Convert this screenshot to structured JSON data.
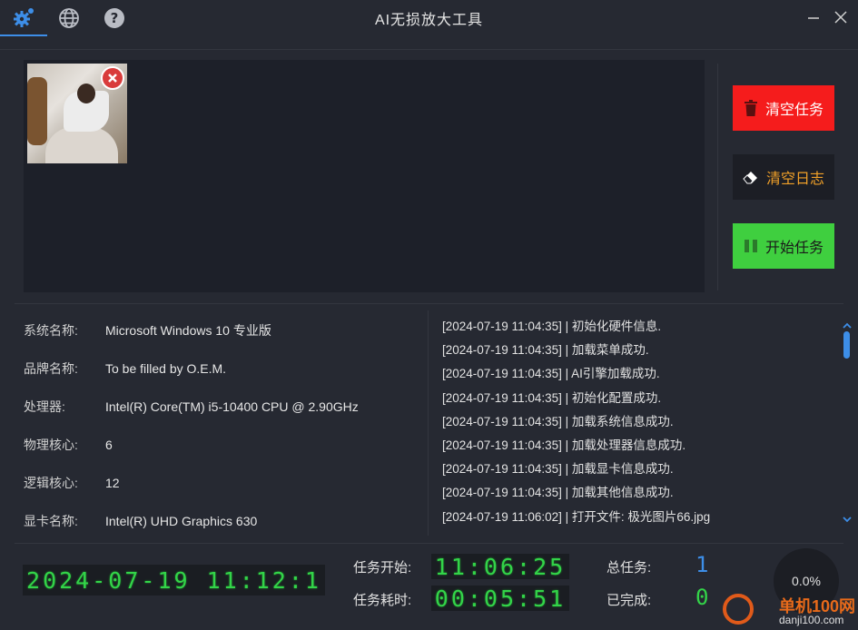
{
  "window": {
    "title": "AI无损放大工具"
  },
  "toolbar": {
    "icons": [
      "gear-icon",
      "globe-icon",
      "help-icon"
    ],
    "accent": "#3d8ee8"
  },
  "actions": {
    "clear_tasks": "清空任务",
    "clear_log": "清空日志",
    "start_task": "开始任务",
    "colors": {
      "clear_tasks": "#f51c1c",
      "clear_log_text": "#f0a028",
      "start_task": "#3fcf3f"
    }
  },
  "system_info": [
    {
      "label": "系统名称:",
      "value": "Microsoft Windows 10 专业版"
    },
    {
      "label": "品牌名称:",
      "value": "To be filled by O.E.M."
    },
    {
      "label": "处理器:",
      "value": "Intel(R) Core(TM) i5-10400 CPU @ 2.90GHz"
    },
    {
      "label": "物理核心:",
      "value": "6"
    },
    {
      "label": "逻辑核心:",
      "value": "12"
    },
    {
      "label": "显卡名称:",
      "value": "Intel(R) UHD Graphics 630"
    }
  ],
  "log": [
    "[2024-07-19 11:04:35] | 初始化硬件信息.",
    "[2024-07-19 11:04:35] | 加载菜单成功.",
    "[2024-07-19 11:04:35] | AI引擎加载成功.",
    "[2024-07-19 11:04:35] | 初始化配置成功.",
    "[2024-07-19 11:04:35] | 加载系统信息成功.",
    "[2024-07-19 11:04:35] | 加载处理器信息成功.",
    "[2024-07-19 11:04:35] | 加载显卡信息成功.",
    "[2024-07-19 11:04:35] | 加载其他信息成功.",
    "[2024-07-19 11:06:02] | 打开文件: 极光图片66.jpg"
  ],
  "status": {
    "clock": "2024-07-19 11:12:1",
    "task_start_label": "任务开始:",
    "task_start": "11:06:25",
    "task_elapsed_label": "任务耗时:",
    "task_elapsed": "00:05:51",
    "total_label": "总任务:",
    "total": "1",
    "total_color": "#3d8ee8",
    "done_label": "已完成:",
    "done": "0",
    "done_color": "#33d449",
    "progress_text": "0.0%",
    "progress": 0.0
  },
  "watermark": {
    "cn": "单机100网",
    "en": "danji100.com"
  }
}
